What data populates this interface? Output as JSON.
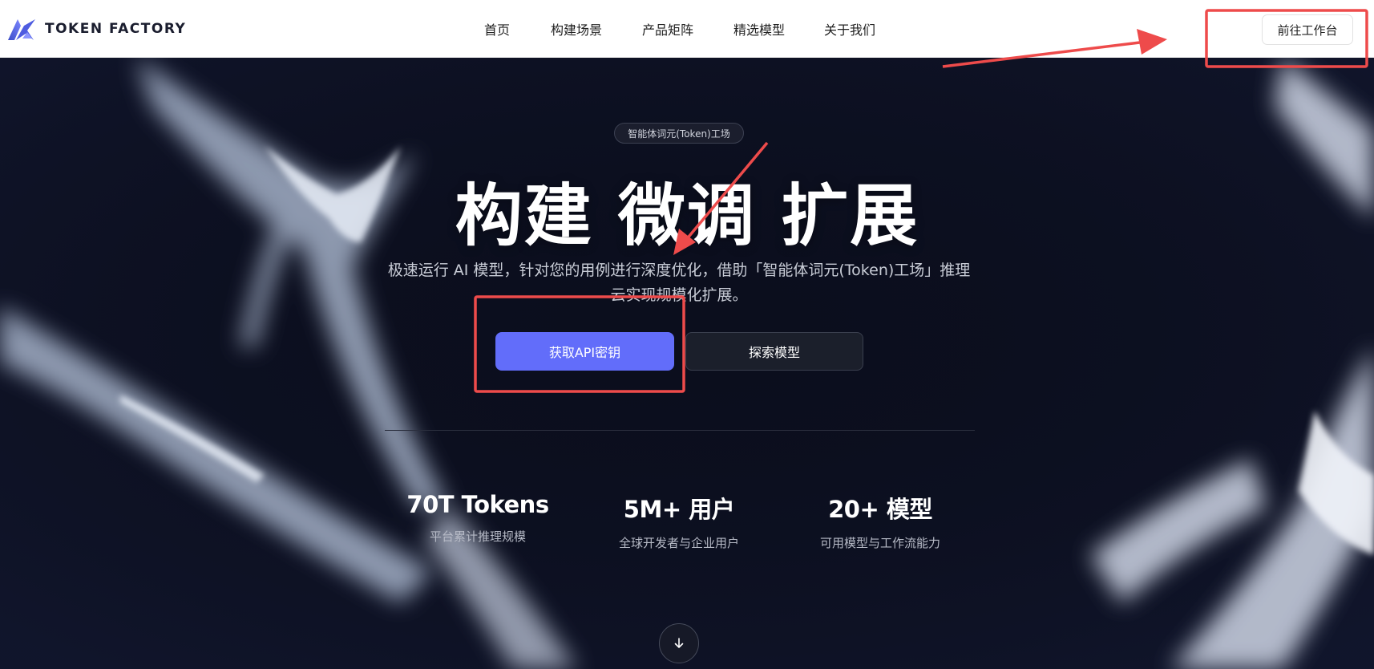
{
  "header": {
    "logo_text": "TOKEN FACTORY",
    "nav": [
      "首页",
      "构建场景",
      "产品矩阵",
      "精选模型",
      "关于我们"
    ],
    "workbench_label": "前往工作台"
  },
  "hero": {
    "badge": "智能体词元(Token)工场",
    "title": "构建 微调 扩展",
    "subtitle": "极速运行 AI 模型，针对您的用例进行深度优化，借助「智能体词元(Token)工场」推理云实现规模化扩展。",
    "primary_button": "获取API密钥",
    "secondary_button": "探索模型"
  },
  "stats": [
    {
      "value": "70T Tokens",
      "label": "平台累计推理规模"
    },
    {
      "value": "5M+ 用户",
      "label": "全球开发者与企业用户"
    },
    {
      "value": "20+ 模型",
      "label": "可用模型与工作流能力"
    }
  ],
  "icons": {
    "logo": "token-factory-logo-icon",
    "scroll": "arrow-down-icon"
  },
  "colors": {
    "accent": "#626dfa",
    "hero_bg": "#0b0e1d",
    "annotation": "#ee4b4b"
  }
}
